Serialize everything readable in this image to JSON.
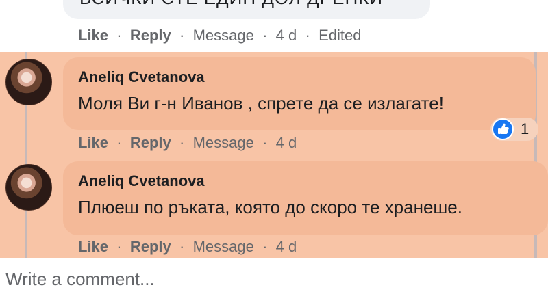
{
  "top_comment": {
    "text": "ВСИЧКИ СТЕ ЕДИН ДОЛ ДРЕНКИ",
    "like_label": "Like",
    "reply_label": "Reply",
    "message_label": "Message",
    "time": "4 d",
    "edited_label": "Edited"
  },
  "comments": [
    {
      "author": "Aneliq Cvetanova",
      "text": "Моля Ви г-н Иванов , спрете да се излагате!",
      "like_label": "Like",
      "reply_label": "Reply",
      "message_label": "Message",
      "time": "4 d",
      "reaction_count": "1"
    },
    {
      "author": "Aneliq Cvetanova",
      "text": "Плюеш по ръката, която до скоро те хранеше.",
      "like_label": "Like",
      "reply_label": "Reply",
      "message_label": "Message",
      "time": "4 d"
    }
  ],
  "composer": {
    "placeholder": "Write a comment..."
  },
  "colors": {
    "highlight": "#f8c4a6",
    "bubble": "#f4b998",
    "like_blue": "#1877f2",
    "meta_gray": "#65676b"
  }
}
